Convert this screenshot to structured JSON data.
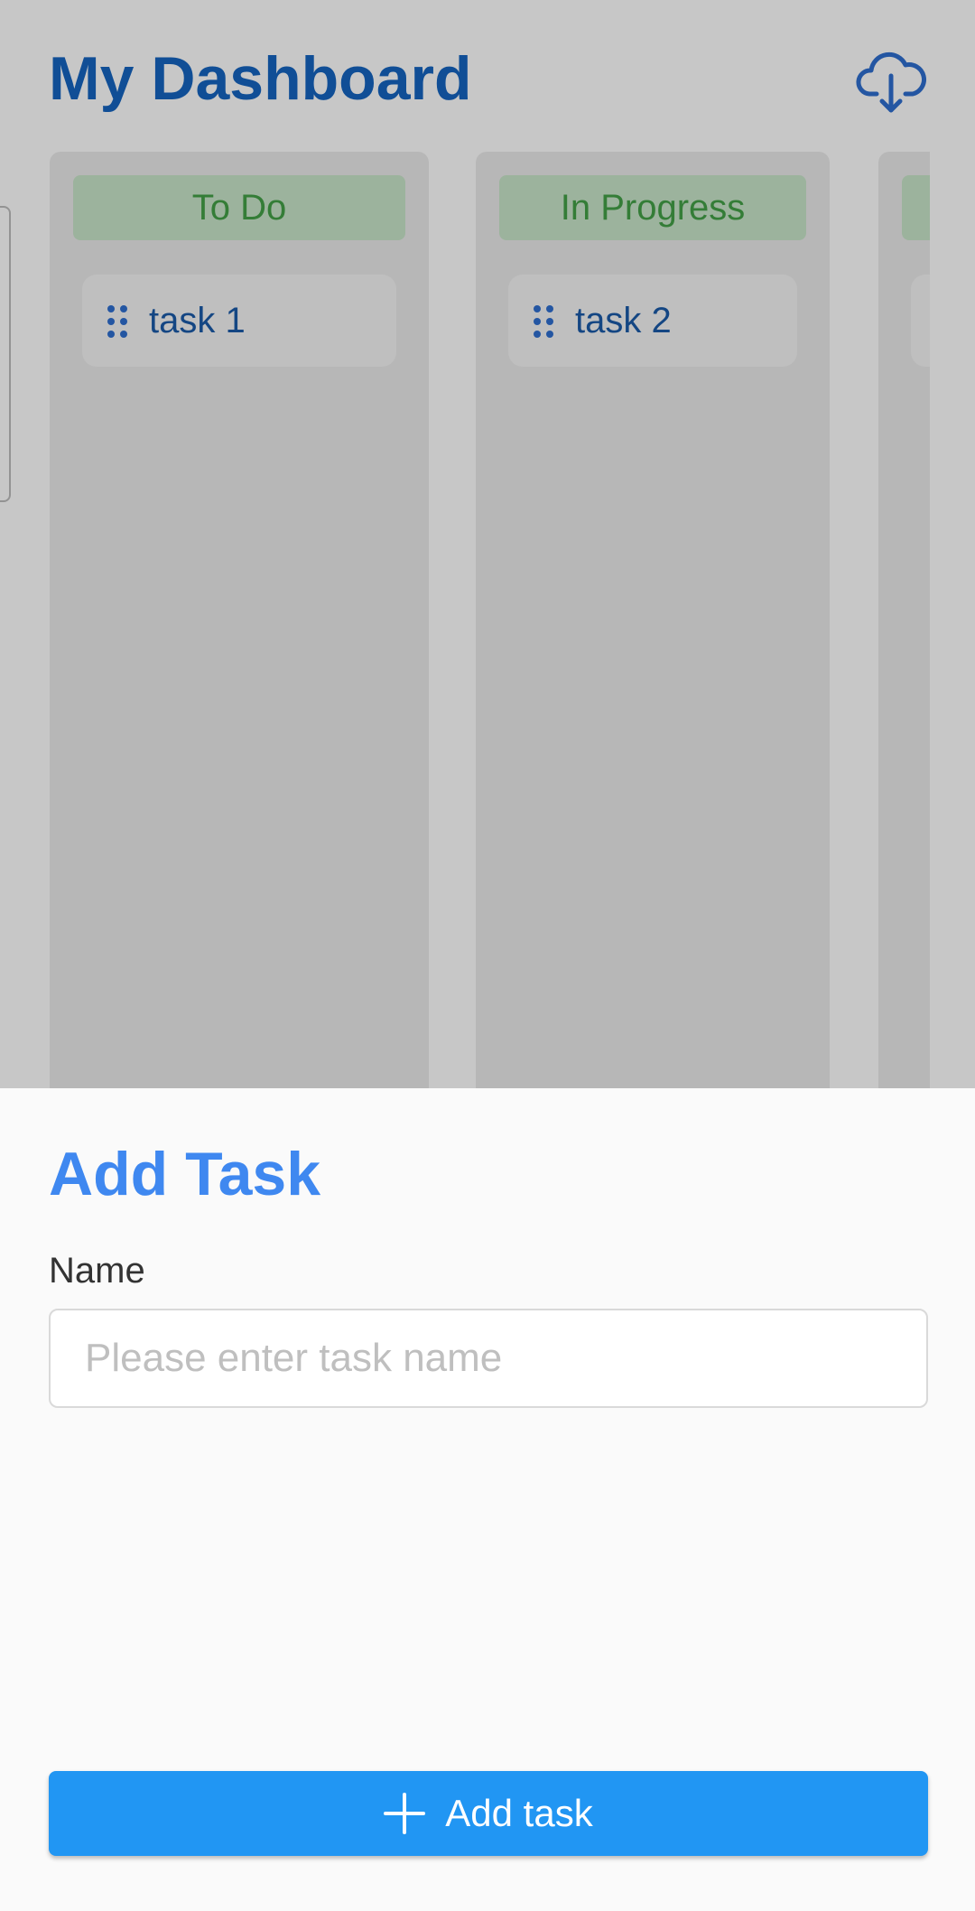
{
  "dashboard": {
    "title": "My Dashboard",
    "download_icon": "cloud-download-icon",
    "columns": [
      {
        "title": "To Do",
        "tasks": [
          {
            "label": "task 1",
            "icon": "drag-handle-icon"
          }
        ]
      },
      {
        "title": "In Progress",
        "tasks": [
          {
            "label": "task 2",
            "icon": "drag-handle-icon"
          }
        ]
      },
      {
        "title": "",
        "tasks": [
          {
            "label": "",
            "icon": ""
          }
        ]
      }
    ]
  },
  "sheet": {
    "title": "Add Task",
    "name_label": "Name",
    "name_value": "",
    "name_placeholder": "Please enter task name",
    "submit_label": "Add task",
    "submit_icon": "plus-icon"
  },
  "colors": {
    "title_blue": "#1565c0",
    "sheet_title_blue": "#3f88f0",
    "column_header_bg": "#c8e6c9",
    "column_header_text": "#43a047",
    "button_bg": "#2196f3"
  }
}
